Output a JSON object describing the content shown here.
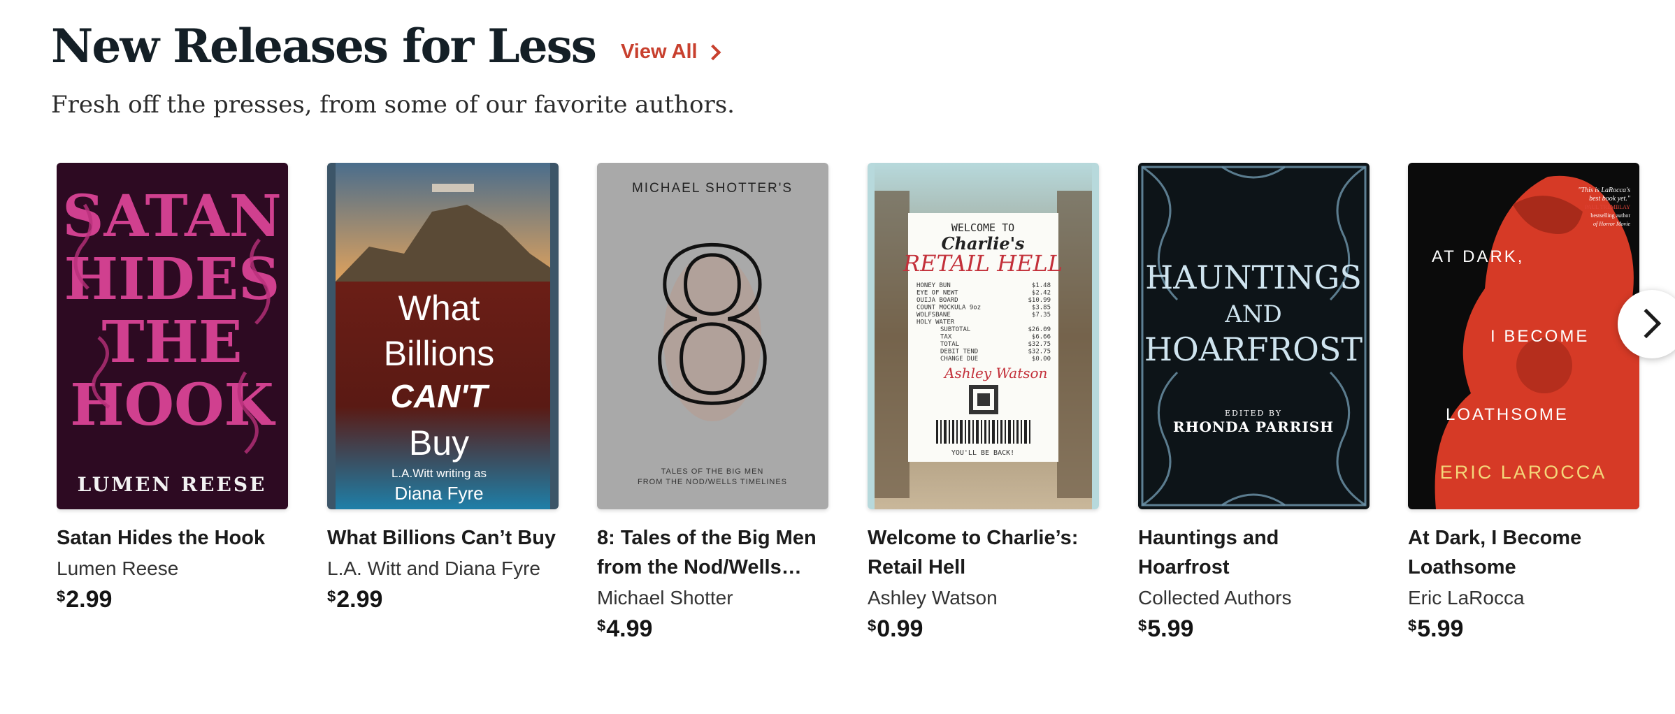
{
  "section": {
    "title": "New Releases for Less",
    "view_all": "View All",
    "subtitle": "Fresh off the presses, from some of our favorite authors."
  },
  "books": [
    {
      "title": "Satan Hides the Hook",
      "author": "Lumen Reese",
      "currency": "$",
      "price": "2.99",
      "cover_lines": [
        "SATAN",
        "HIDES",
        "THE",
        "HOOK"
      ],
      "cover_author": "LUMEN REESE"
    },
    {
      "title": "What Billions Can’t Buy",
      "author": "L.A. Witt and Diana Fyre",
      "currency": "$",
      "price": "2.99",
      "cover_lines": [
        "What",
        "Billions",
        "CAN'T",
        "Buy"
      ],
      "cover_author_1": "L.A.Witt writing as",
      "cover_author_2": "Diana Fyre"
    },
    {
      "title": "8: Tales of the Big Men from the Nod/Wells…",
      "author": "Michael Shotter",
      "currency": "$",
      "price": "4.99",
      "cover_top": "MICHAEL SHOTTER'S",
      "cover_numeral": "8",
      "cover_bottom_1": "TALES OF THE BIG MEN",
      "cover_bottom_2": "FROM THE NOD/WELLS TIMELINES"
    },
    {
      "title": "Welcome to Charlie’s: Retail Hell",
      "author": "Ashley Watson",
      "currency": "$",
      "price": "0.99",
      "cover_welcome": "WELCOME TO",
      "cover_charlies": "Charlie's",
      "cover_retail": "RETAIL HELL",
      "cover_receipt": [
        [
          "HONEY BUN",
          "$1.48"
        ],
        [
          "EYE OF NEWT",
          "$2.42"
        ],
        [
          "OUIJA BOARD",
          "$10.99"
        ],
        [
          "COUNT MOCKULA 9oz",
          "$3.85"
        ],
        [
          "WOLFSBANE",
          "$7.35"
        ],
        [
          "HOLY WATER",
          ""
        ],
        [
          "SUBTOTAL",
          "$26.09"
        ],
        [
          "TAX",
          "$6.66"
        ],
        [
          "TOTAL",
          "$32.75"
        ],
        [
          "DEBIT TEND",
          "$32.75"
        ],
        [
          "CHANGE DUE",
          "$0.00"
        ]
      ],
      "cover_signature": "Ashley Watson",
      "cover_footer": "YOU'LL BE BACK!"
    },
    {
      "title": "Hauntings and Hoarfrost",
      "author": "Collected Authors",
      "currency": "$",
      "price": "5.99",
      "cover_line_1": "HAUNTINGS",
      "cover_line_2": "AND",
      "cover_line_3": "HOARFROST",
      "cover_edited": "EDITED BY",
      "cover_editor": "RHONDA PARRISH"
    },
    {
      "title": "At Dark, I Become Loathsome",
      "author": "Eric LaRocca",
      "currency": "$",
      "price": "5.99",
      "cover_quote_1": "\"This is LaRocca's",
      "cover_quote_2": "best book yet.\"",
      "cover_quote_name": "PAUL TREMBLAY",
      "cover_quote_3": "bestselling author",
      "cover_quote_4": "of Horror Movie",
      "cover_line_1": "AT DARK,",
      "cover_line_2": "I BECOME",
      "cover_line_3": "LOATHSOME",
      "cover_author": "ERIC LAROCCA"
    }
  ]
}
